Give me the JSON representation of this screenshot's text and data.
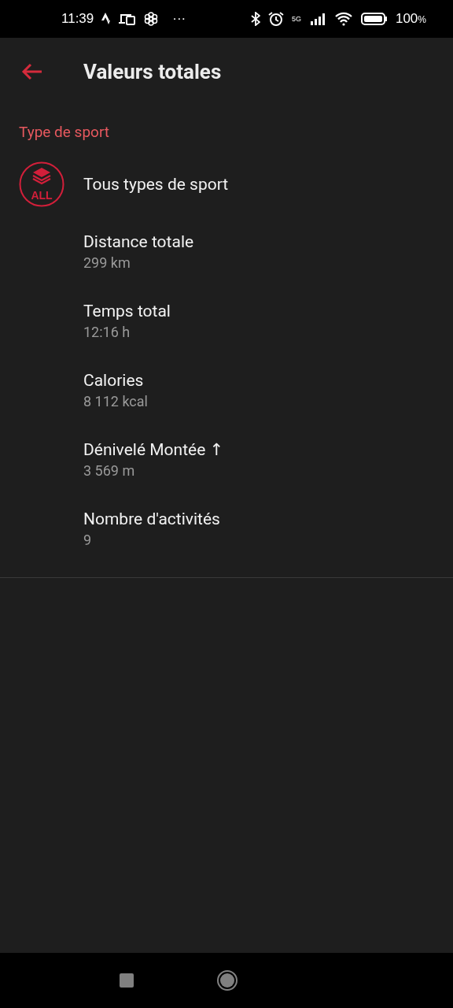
{
  "status_bar": {
    "time": "11:39",
    "more": "···",
    "network": "5G",
    "battery": "100",
    "battery_unit": "%"
  },
  "app_bar": {
    "title": "Valeurs totales"
  },
  "section": {
    "label": "Type de sport"
  },
  "sport": {
    "icon_label": "ALL",
    "name": "Tous types de sport"
  },
  "stats": [
    {
      "label": "Distance totale",
      "value": "299 km"
    },
    {
      "label": "Temps total",
      "value": "12:16 h"
    },
    {
      "label": "Calories",
      "value": "8 112 kcal"
    },
    {
      "label": "Dénivelé Montée ↑",
      "value": "3 569 m"
    },
    {
      "label": "Nombre d'activités",
      "value": "9"
    }
  ]
}
